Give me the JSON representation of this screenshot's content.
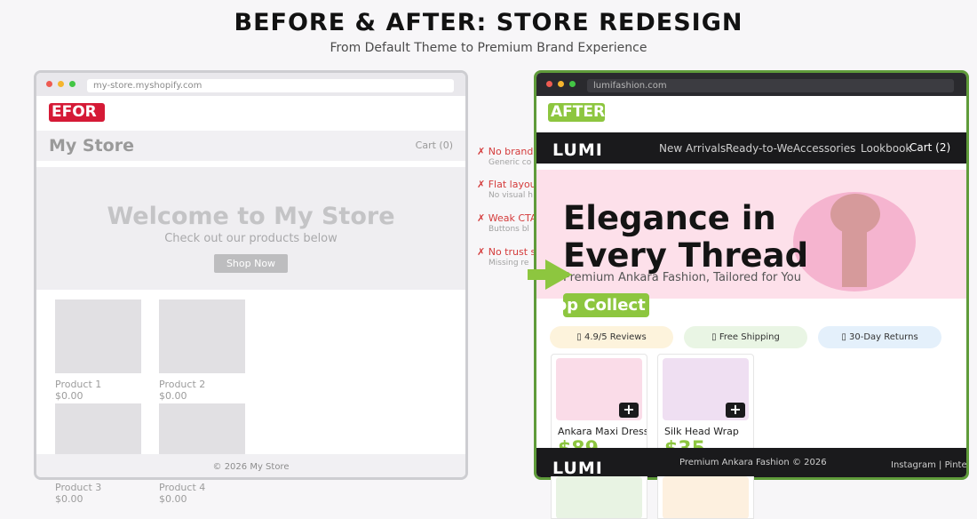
{
  "title": "BEFORE & AFTER: STORE REDESIGN",
  "subtitle": "From Default Theme to Premium Brand Experience",
  "before": {
    "url": "my-store.myshopify.com",
    "badge": "EFOR",
    "store_name": "My Store",
    "cart": "Cart (0)",
    "hero_title": "Welcome to My Store",
    "hero_sub": "Check out our products below",
    "shop_button": "Shop Now",
    "products": [
      {
        "name": "Product 1",
        "price": "$0.00"
      },
      {
        "name": "Product 2",
        "price": "$0.00"
      },
      {
        "name": "Product 3",
        "price": "$0.00"
      },
      {
        "name": "Product 4",
        "price": "$0.00"
      }
    ],
    "footer": "© 2026 My Store"
  },
  "issues": [
    {
      "title": "✗ No brand",
      "sub": "Generic co"
    },
    {
      "title": "✗ Flat layou",
      "sub": "No visual h"
    },
    {
      "title": "✗ Weak CTA",
      "sub": "Buttons bl"
    },
    {
      "title": "✗ No trust s",
      "sub": "Missing re"
    }
  ],
  "after": {
    "url": "lumifashion.com",
    "badge": "AFTER",
    "logo": "LUMI",
    "nav": [
      "New Arrivals",
      "Ready-to-Wea",
      "Accessories",
      "Lookbook"
    ],
    "cart": "Cart (2)",
    "hero_title_1": "Elegance in",
    "hero_title_2": "Every Thread",
    "hero_tagline": "Premium Ankara Fashion, Tailored for You",
    "shop_button": "Shop Collect",
    "trust": [
      "▯ 4.9/5 Reviews",
      "▯ Free Shipping",
      "▯ 30-Day Returns"
    ],
    "products": [
      {
        "name": "Ankara Maxi Dress",
        "price": "$89",
        "add": "+"
      },
      {
        "name": "Silk Head Wrap",
        "price": "$35",
        "add": "+"
      }
    ],
    "footer_logo": "LUMI",
    "footer_copy": "Premium Ankara Fashion © 2026",
    "footer_social": "Instagram  |  Pinte"
  },
  "colors": {
    "accent": "#8dc63f",
    "before_badge": "#d51a36",
    "after_border": "#5f9b3a",
    "issue_red": "#d43b3b",
    "dark": "#1a1a1c",
    "hero_pink": "#fde0ea"
  }
}
